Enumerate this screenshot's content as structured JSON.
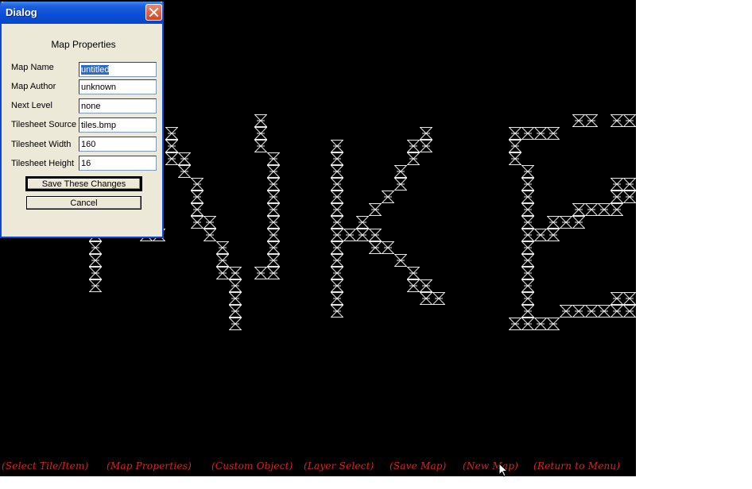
{
  "dialog": {
    "title": "Dialog",
    "heading": "Map Properties",
    "fields": [
      {
        "label": "Map Name",
        "value": "untitled",
        "selected": true
      },
      {
        "label": "Map Author",
        "value": "unknown"
      },
      {
        "label": "Next Level",
        "value": "none"
      },
      {
        "label": "Tilesheet Source",
        "value": "tiles.bmp"
      },
      {
        "label": "Tilesheet Width",
        "value": "160"
      },
      {
        "label": "Tilesheet Height",
        "value": "16"
      }
    ],
    "save_label": "Save These Changes",
    "cancel_label": "Cancel"
  },
  "menu": [
    "(Select Tile/Item)",
    "(Map Properties)",
    "(Custom Object)",
    "(Layer Select)",
    "(Save Map)",
    "(New Map)",
    "(Return to Menu)"
  ],
  "colors": {
    "canvas": "#000000",
    "tile": "#e8e8e8",
    "menu_text": "#e02020",
    "titlebar": "#0a4fd6"
  },
  "icons": {
    "tile": "lattice-tile-icon",
    "close": "close-icon",
    "cursor": "mouse-pointer-icon"
  }
}
